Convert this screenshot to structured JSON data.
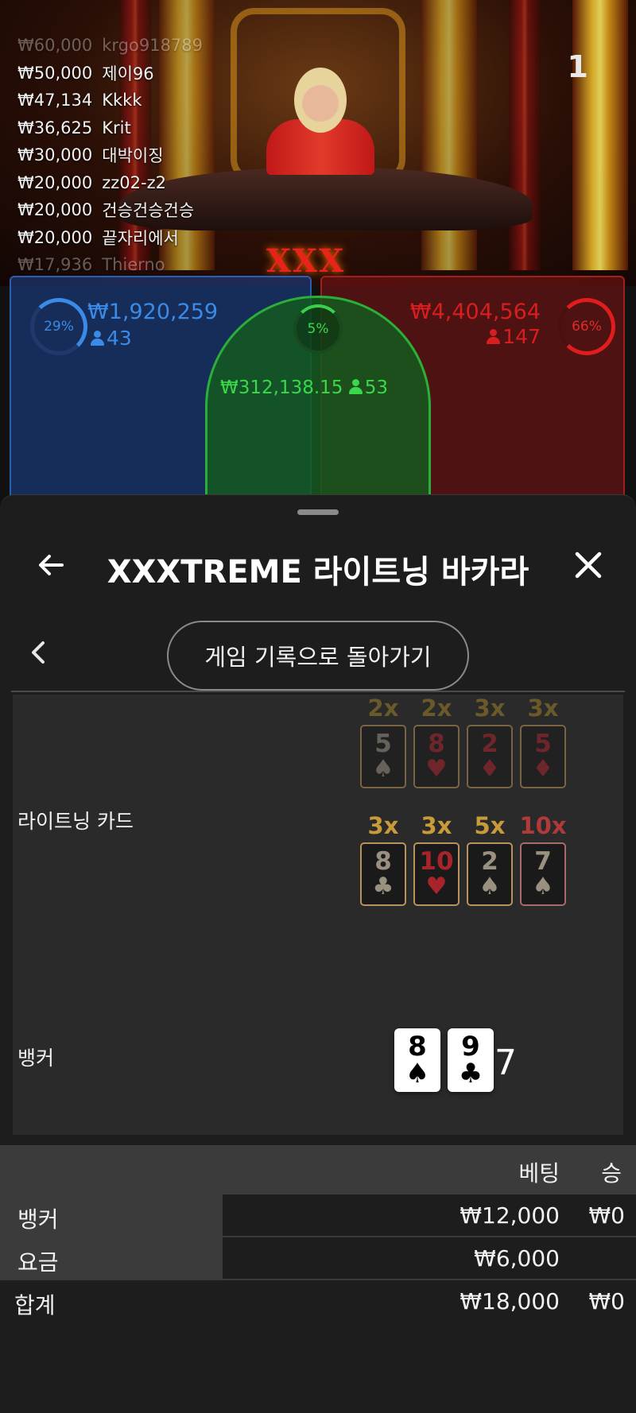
{
  "round_number": "1",
  "stream_logo": "XXX",
  "chat": [
    {
      "amount": "₩60,000",
      "name": "krgo918789"
    },
    {
      "amount": "₩50,000",
      "name": "제이96"
    },
    {
      "amount": "₩47,134",
      "name": "Kkkk"
    },
    {
      "amount": "₩36,625",
      "name": "Krit"
    },
    {
      "amount": "₩30,000",
      "name": "대박이징"
    },
    {
      "amount": "₩20,000",
      "name": "zz02-z2"
    },
    {
      "amount": "₩20,000",
      "name": "건승건승건승"
    },
    {
      "amount": "₩20,000",
      "name": "끝자리에서"
    },
    {
      "amount": "₩17,936",
      "name": "Thierno"
    }
  ],
  "spots": {
    "player": {
      "percent": "29%",
      "amount": "₩1,920,259",
      "users": "43",
      "color": "#3a8ae8"
    },
    "tie": {
      "percent": "5%",
      "amount": "₩312,138.15",
      "users": "53",
      "color": "#3ad84a"
    },
    "banker": {
      "percent": "66%",
      "amount": "₩4,404,564",
      "users": "147",
      "color": "#d81e1e"
    }
  },
  "sheet": {
    "title": "XXXTREME 라이트닝 바카라",
    "back_icon": "arrow-left-icon",
    "close_icon": "close-icon",
    "back_to_history": "게임 기록으로 돌아가기"
  },
  "lightning": {
    "label": "라이트닝 카드",
    "row1": [
      {
        "mult": "2x",
        "rank": "5",
        "suit": "♠",
        "color": "black"
      },
      {
        "mult": "2x",
        "rank": "8",
        "suit": "♥",
        "color": "red"
      },
      {
        "mult": "3x",
        "rank": "2",
        "suit": "♦",
        "color": "red"
      },
      {
        "mult": "3x",
        "rank": "5",
        "suit": "♦",
        "color": "red"
      }
    ],
    "row2": [
      {
        "mult": "3x",
        "rank": "8",
        "suit": "♣",
        "color": "black"
      },
      {
        "mult": "3x",
        "rank": "10",
        "suit": "♥",
        "color": "red"
      },
      {
        "mult": "5x",
        "rank": "2",
        "suit": "♠",
        "color": "black"
      },
      {
        "mult": "10x",
        "rank": "7",
        "suit": "♠",
        "color": "black"
      }
    ]
  },
  "banker_hand": {
    "label": "뱅커",
    "cards": [
      {
        "rank": "8",
        "suit": "♠"
      },
      {
        "rank": "9",
        "suit": "♣"
      }
    ],
    "score": "7"
  },
  "results": {
    "headers": {
      "bet": "베팅",
      "win": "승"
    },
    "rows": [
      {
        "label": "뱅커",
        "bet": "₩12,000",
        "win": "₩0"
      },
      {
        "label": "요금",
        "bet": "₩6,000",
        "win": ""
      }
    ],
    "total": {
      "label": "합계",
      "bet": "₩18,000",
      "win": "₩0"
    }
  }
}
